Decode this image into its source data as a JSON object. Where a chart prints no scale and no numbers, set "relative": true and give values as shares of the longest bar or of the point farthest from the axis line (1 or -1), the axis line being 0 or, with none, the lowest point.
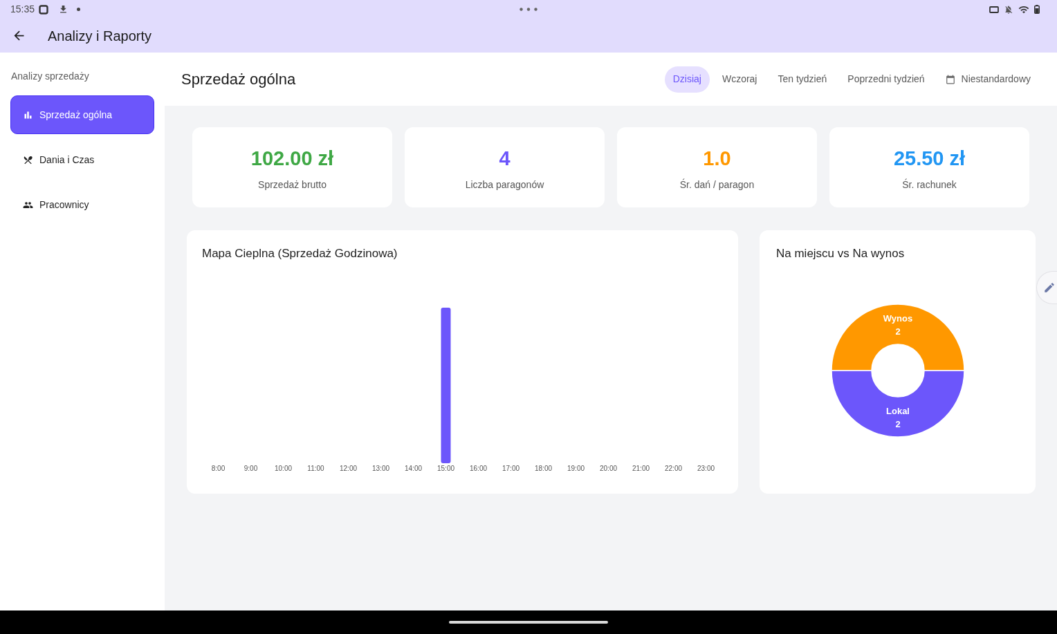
{
  "status_bar": {
    "time": "15:35"
  },
  "app_bar": {
    "title": "Analizy i Raporty"
  },
  "sidebar": {
    "section_title": "Analizy sprzedaży",
    "items": [
      {
        "label": "Sprzedaż ogólna",
        "selected": true
      },
      {
        "label": "Dania i Czas",
        "selected": false
      },
      {
        "label": "Pracownicy",
        "selected": false
      }
    ]
  },
  "header": {
    "title": "Sprzedaż ogólna",
    "tabs": [
      {
        "label": "Dzisiaj",
        "selected": true,
        "kind": "preset"
      },
      {
        "label": "Wczoraj",
        "selected": false,
        "kind": "preset"
      },
      {
        "label": "Ten tydzień",
        "selected": false,
        "kind": "preset"
      },
      {
        "label": "Poprzedni tydzień",
        "selected": false,
        "kind": "preset"
      },
      {
        "label": "Niestandardowy",
        "selected": false,
        "kind": "custom"
      }
    ]
  },
  "stats": [
    {
      "value": "102.00 zł",
      "label": "Sprzedaż brutto",
      "color": "#3fa845"
    },
    {
      "value": "4",
      "label": "Liczba paragonów",
      "color": "#6c56fb"
    },
    {
      "value": "1.0",
      "label": "Śr. dań / paragon",
      "color": "#ff9800"
    },
    {
      "value": "25.50 zł",
      "label": "Śr. rachunek",
      "color": "#2196f3"
    }
  ],
  "heatmap": {
    "title": "Mapa Cieplna (Sprzedaż Godzinowa)",
    "chart_data": {
      "type": "bar",
      "relative": true,
      "categories": [
        "8:00",
        "9:00",
        "10:00",
        "11:00",
        "12:00",
        "13:00",
        "14:00",
        "15:00",
        "16:00",
        "17:00",
        "18:00",
        "19:00",
        "20:00",
        "21:00",
        "22:00",
        "23:00"
      ],
      "series": [
        {
          "color": "#6c56fb",
          "values": [
            0,
            0,
            0,
            0,
            0,
            0,
            0,
            1,
            0,
            0,
            0,
            0,
            0,
            0,
            0,
            0
          ]
        }
      ]
    }
  },
  "order_types": {
    "title": "Na miejscu vs Na wynos",
    "chart_data": {
      "type": "donut",
      "categories": [
        "Wynos",
        "Lokal"
      ],
      "values": [
        2,
        2
      ],
      "colors": [
        "#ff9800",
        "#6c56fb"
      ],
      "data_labels": true
    }
  }
}
